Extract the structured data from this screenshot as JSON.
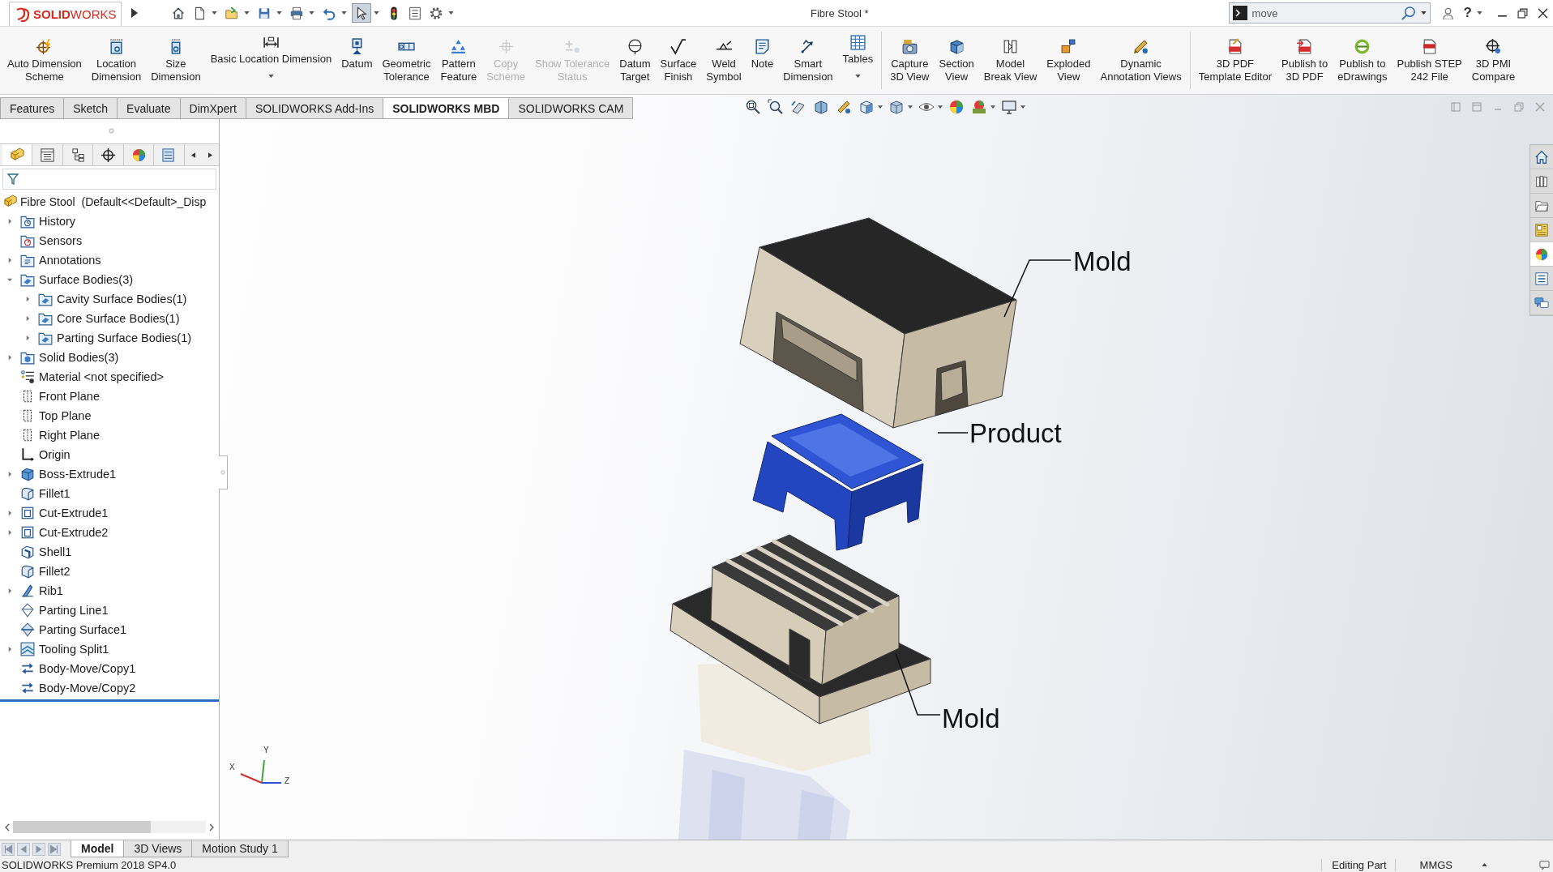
{
  "title_bar": {
    "logo_text": "**SOLID**WORKS",
    "document_title": "Fibre Stool *",
    "search": {
      "value": "move"
    },
    "help": "?"
  },
  "quick_access": [
    {
      "selected": false,
      "dropdown": false
    },
    {
      "selected": false,
      "dropdown": true
    },
    {
      "selected": false,
      "dropdown": true
    },
    {
      "selected": false,
      "dropdown": true
    },
    {
      "selected": false,
      "dropdown": true
    },
    {
      "selected": false,
      "dropdown": true
    },
    {
      "selected": true,
      "dropdown": true
    },
    {
      "selected": false,
      "dropdown": false
    },
    {
      "selected": false,
      "dropdown": false
    },
    {
      "selected": false,
      "dropdown": true
    }
  ],
  "ribbon": {
    "groups": [
      {
        "buttons": [
          {
            "label": "Auto Dimension\nScheme",
            "disabled": false,
            "dropdown": false
          },
          {
            "label": "Location\nDimension",
            "disabled": false,
            "dropdown": false
          },
          {
            "label": "Size\nDimension",
            "disabled": false,
            "dropdown": false
          },
          {
            "label": "Basic Location Dimension",
            "disabled": false,
            "dropdown": true
          },
          {
            "label": "Datum",
            "disabled": false,
            "dropdown": false
          },
          {
            "label": "Geometric\nTolerance",
            "disabled": false,
            "dropdown": false
          },
          {
            "label": "Pattern\nFeature",
            "disabled": false,
            "dropdown": false
          },
          {
            "label": "Copy\nScheme",
            "disabled": true,
            "dropdown": false
          },
          {
            "label": "Show Tolerance\nStatus",
            "disabled": true,
            "dropdown": false
          },
          {
            "label": "Datum\nTarget",
            "disabled": false,
            "dropdown": false
          },
          {
            "label": "Surface\nFinish",
            "disabled": false,
            "dropdown": false
          },
          {
            "label": "Weld\nSymbol",
            "disabled": false,
            "dropdown": false
          },
          {
            "label": "Note",
            "disabled": false,
            "dropdown": false
          },
          {
            "label": "Smart\nDimension",
            "disabled": false,
            "dropdown": false
          },
          {
            "label": "Tables",
            "disabled": false,
            "dropdown": true
          }
        ]
      },
      {
        "buttons": [
          {
            "label": "Capture\n3D View",
            "disabled": false,
            "dropdown": false
          },
          {
            "label": "Section\nView",
            "disabled": false,
            "dropdown": false
          },
          {
            "label": "Model\nBreak View",
            "disabled": false,
            "dropdown": false
          },
          {
            "label": "Exploded\nView",
            "disabled": false,
            "dropdown": false
          },
          {
            "label": "Dynamic\nAnnotation Views",
            "disabled": false,
            "dropdown": false
          }
        ]
      },
      {
        "buttons": [
          {
            "label": "3D PDF\nTemplate Editor",
            "disabled": false,
            "dropdown": false
          },
          {
            "label": "Publish to\n3D PDF",
            "disabled": false,
            "dropdown": false
          },
          {
            "label": "Publish to\neDrawings",
            "disabled": false,
            "dropdown": false
          },
          {
            "label": "Publish STEP\n242 File",
            "disabled": false,
            "dropdown": false
          },
          {
            "label": "3D PMI\nCompare",
            "disabled": false,
            "dropdown": false
          }
        ]
      }
    ]
  },
  "command_tabs": [
    {
      "label": "Features",
      "selected": false
    },
    {
      "label": "Sketch",
      "selected": false
    },
    {
      "label": "Evaluate",
      "selected": false
    },
    {
      "label": "DimXpert",
      "selected": false
    },
    {
      "label": "SOLIDWORKS Add-Ins",
      "selected": false
    },
    {
      "label": "SOLIDWORKS MBD",
      "selected": true
    },
    {
      "label": "SOLIDWORKS CAM",
      "selected": false
    }
  ],
  "view_toolbar": [
    {
      "dropdown": false
    },
    {
      "dropdown": false
    },
    {
      "dropdown": false
    },
    {
      "dropdown": false
    },
    {
      "dropdown": false
    },
    {
      "dropdown": true
    },
    {
      "dropdown": true
    },
    {
      "dropdown": true
    },
    {
      "dropdown": false
    },
    {
      "dropdown": true
    },
    {
      "dropdown": true
    }
  ],
  "feature_manager": {
    "tabs": [
      {
        "selected": true
      },
      {
        "selected": false
      },
      {
        "selected": false
      },
      {
        "selected": false
      },
      {
        "selected": false
      },
      {
        "selected": false
      }
    ],
    "root": "Fibre Stool  (Default<<Default>_Disp",
    "items": [
      {
        "label": "History",
        "kind": "history",
        "has_children": true,
        "expanded": false
      },
      {
        "label": "Sensors",
        "kind": "sensors",
        "has_children": false,
        "expanded": false
      },
      {
        "label": "Annotations",
        "kind": "annotations",
        "has_children": true,
        "expanded": false
      },
      {
        "label": "Surface Bodies(3)",
        "kind": "surface-bodies",
        "has_children": true,
        "expanded": true,
        "children": [
          {
            "label": "Cavity Surface Bodies(1)",
            "kind": "surface-bodies",
            "has_children": true,
            "expanded": false
          },
          {
            "label": "Core Surface Bodies(1)",
            "kind": "surface-bodies",
            "has_children": true,
            "expanded": false
          },
          {
            "label": "Parting Surface Bodies(1)",
            "kind": "surface-bodies",
            "has_children": true,
            "expanded": false
          }
        ]
      },
      {
        "label": "Solid Bodies(3)",
        "kind": "solid-bodies",
        "has_children": true,
        "expanded": false
      },
      {
        "label": "Material <not specified>",
        "kind": "material",
        "has_children": false,
        "expanded": false
      },
      {
        "label": "Front Plane",
        "kind": "plane",
        "has_children": false,
        "expanded": false
      },
      {
        "label": "Top Plane",
        "kind": "plane",
        "has_children": false,
        "expanded": false
      },
      {
        "label": "Right Plane",
        "kind": "plane",
        "has_children": false,
        "expanded": false
      },
      {
        "label": "Origin",
        "kind": "origin",
        "has_children": false,
        "expanded": false
      },
      {
        "label": "Boss-Extrude1",
        "kind": "extrude",
        "has_children": true,
        "expanded": false
      },
      {
        "label": "Fillet1",
        "kind": "fillet",
        "has_children": false,
        "expanded": false
      },
      {
        "label": "Cut-Extrude1",
        "kind": "cut",
        "has_children": true,
        "expanded": false
      },
      {
        "label": "Cut-Extrude2",
        "kind": "cut",
        "has_children": true,
        "expanded": false
      },
      {
        "label": "Shell1",
        "kind": "shell",
        "has_children": false,
        "expanded": false
      },
      {
        "label": "Fillet2",
        "kind": "fillet",
        "has_children": false,
        "expanded": false
      },
      {
        "label": "Rib1",
        "kind": "rib",
        "has_children": true,
        "expanded": false
      },
      {
        "label": "Parting Line1",
        "kind": "parting-line",
        "has_children": false,
        "expanded": false
      },
      {
        "label": "Parting Surface1",
        "kind": "parting-surface",
        "has_children": false,
        "expanded": false
      },
      {
        "label": "Tooling Split1",
        "kind": "tooling-split",
        "has_children": true,
        "expanded": false
      },
      {
        "label": "Body-Move/Copy1",
        "kind": "move-copy",
        "has_children": false,
        "expanded": false
      },
      {
        "label": "Body-Move/Copy2",
        "kind": "move-copy",
        "has_children": false,
        "expanded": false
      }
    ]
  },
  "viewport": {
    "callouts": [
      {
        "label": "Mold"
      },
      {
        "label": "Product"
      },
      {
        "label": "Mold"
      }
    ],
    "triad": {
      "x": "X",
      "y": "Y",
      "z": "Z"
    }
  },
  "task_pane": [
    {
      "selected": false
    },
    {
      "selected": false
    },
    {
      "selected": false
    },
    {
      "selected": false
    },
    {
      "selected": true
    },
    {
      "selected": false
    },
    {
      "selected": false
    }
  ],
  "bottom_tabs": [
    {
      "label": "Model",
      "selected": true
    },
    {
      "label": "3D Views",
      "selected": false
    },
    {
      "label": "Motion Study 1",
      "selected": false
    }
  ],
  "status_bar": {
    "product": "SOLIDWORKS Premium 2018 SP4.0",
    "mode": "Editing Part",
    "units": "MMGS"
  }
}
